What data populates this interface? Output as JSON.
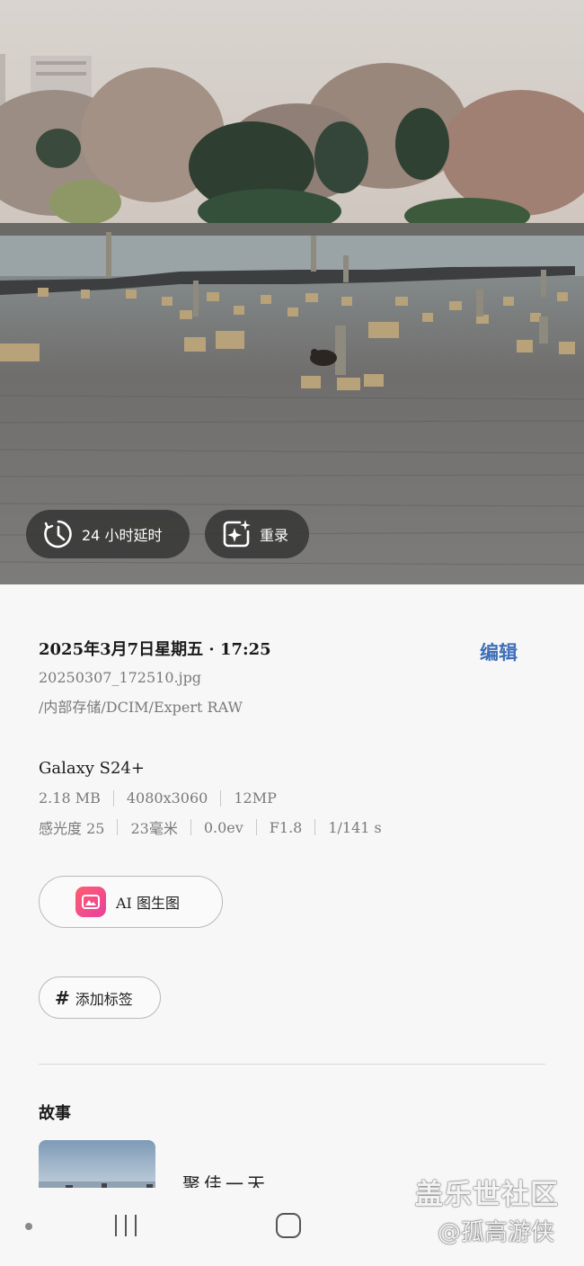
{
  "photo": {
    "timelapse_label": "24 小时延时",
    "rerecord_label": "重录"
  },
  "details": {
    "datetime": "2025年3月7日星期五 · 17:25",
    "edit_label": "编辑",
    "filename": "20250307_172510.jpg",
    "path": "/内部存储/DCIM/Expert RAW",
    "device": "Galaxy S24+",
    "specs_row1": [
      "2.18 MB",
      "4080x3060",
      "12MP"
    ],
    "specs_row2": [
      "感光度 25",
      "23毫米",
      "0.0ev",
      "F1.8",
      "1/141 s"
    ],
    "ai_button_label": "AI 图生图",
    "tag_button_label": "添加标签",
    "story_section_title": "故事",
    "story_label": "聚佳一天"
  },
  "watermark": {
    "line1": "盖乐世社区",
    "line2": "@孤高游侠"
  },
  "colors": {
    "accent": "#3d6fb8",
    "chip_bg": "#323232"
  }
}
